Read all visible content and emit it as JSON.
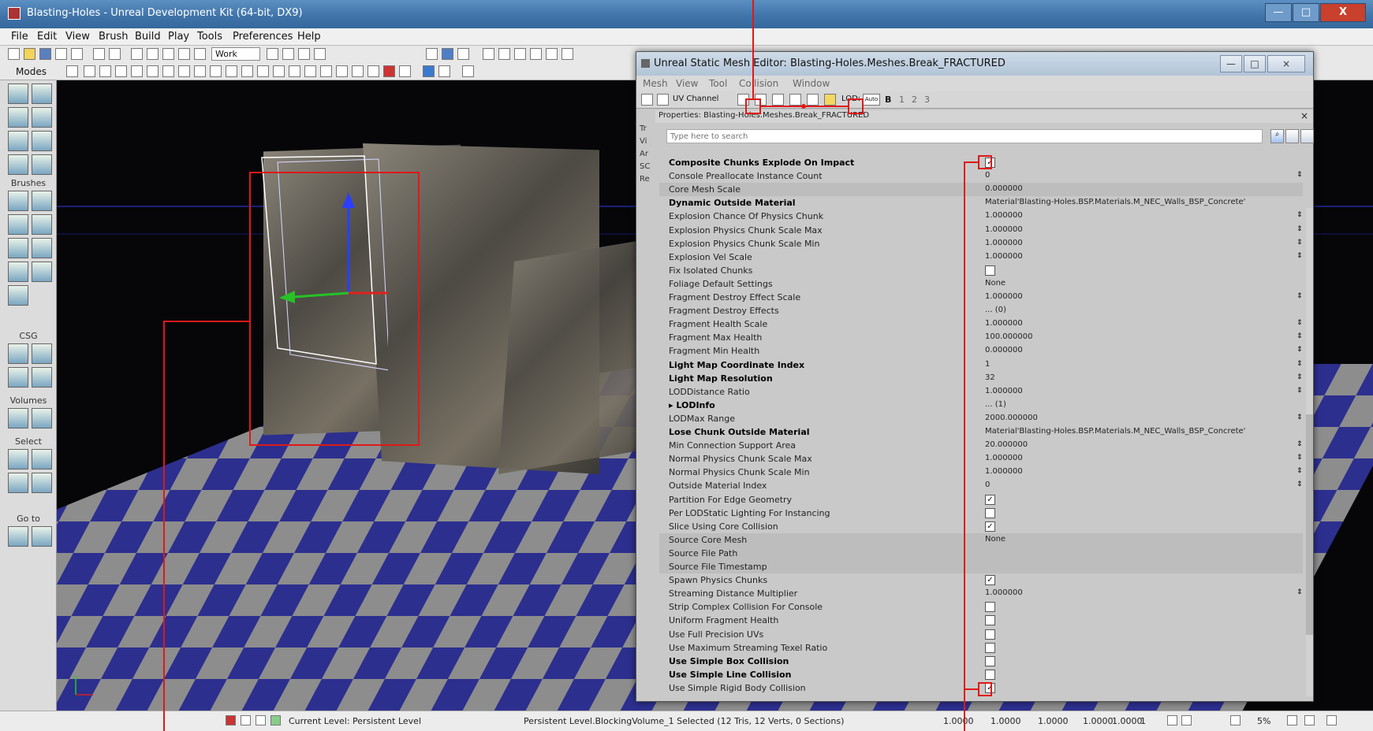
{
  "main_window": {
    "title": "Blasting-Holes - Unreal Development Kit (64-bit, DX9)",
    "min_glyph": "—",
    "max_glyph": "□",
    "close_glyph": "X"
  },
  "menu": [
    "File",
    "Edit",
    "View",
    "Brush",
    "Build",
    "Play",
    "Tools",
    "Preferences",
    "Help"
  ],
  "toolbar": {
    "mode_combo": "Work",
    "modes_label": "Modes"
  },
  "modes_panel": {
    "brushes": "Brushes",
    "csg": "CSG",
    "volumes": "Volumes",
    "select": "Select",
    "goto": "Go to"
  },
  "status_bar": {
    "current_level": "Current Level: Persistent Level",
    "selection": "Persistent Level.BlockingVolume_1 Selected (12 Tris, 12 Verts, 0 Sections)",
    "v1": "1.0000",
    "v2": "1.0000",
    "v3": "1.0000",
    "v4": "1.0000",
    "v5": "1.0000",
    "count": "1",
    "pct": "5%"
  },
  "mesh_editor": {
    "title": "Unreal Static Mesh Editor: Blasting-Holes.Meshes.Break_FRACTURED",
    "menu": [
      "Mesh",
      "View",
      "Tool",
      "Collision",
      "Window"
    ],
    "uv_channel": "UV Channel",
    "lod_label": "LOD:",
    "lod_auto": "Auto",
    "lod_levels": [
      "B",
      "1",
      "2",
      "3"
    ],
    "properties_title": "Properties: Blasting-Holes.Meshes.Break_FRACTURED",
    "close_glyph": "×",
    "search_placeholder": "Type here to search",
    "side_labels": [
      "Tr",
      "Vi",
      "Ar",
      "SC",
      "Re"
    ]
  },
  "properties": [
    {
      "name": "Composite Chunks Explode On Impact",
      "bold": true,
      "checkbox": true,
      "checked": true
    },
    {
      "name": "Console Preallocate Instance Count",
      "value": "0",
      "arrows": true
    },
    {
      "name": "Core Mesh Scale",
      "value": "0.000000",
      "shaded": true
    },
    {
      "name": "Dynamic Outside Material",
      "bold": true,
      "value": "Material'Blasting-Holes.BSP.Materials.M_NEC_Walls_BSP_Concrete'"
    },
    {
      "name": "Explosion Chance Of Physics Chunk",
      "value": "1.000000",
      "arrows": true
    },
    {
      "name": "Explosion Physics Chunk Scale Max",
      "value": "1.000000",
      "arrows": true
    },
    {
      "name": "Explosion Physics Chunk Scale Min",
      "value": "1.000000",
      "arrows": true
    },
    {
      "name": "Explosion Vel Scale",
      "value": "1.000000",
      "arrows": true
    },
    {
      "name": "Fix Isolated Chunks",
      "checkbox": true,
      "checked": false
    },
    {
      "name": "Foliage Default Settings",
      "value": "None"
    },
    {
      "name": "Fragment Destroy Effect Scale",
      "value": "1.000000",
      "arrows": true
    },
    {
      "name": "Fragment Destroy Effects",
      "value": "... (0)"
    },
    {
      "name": "Fragment Health Scale",
      "value": "1.000000",
      "arrows": true
    },
    {
      "name": "Fragment Max Health",
      "value": "100.000000",
      "arrows": true
    },
    {
      "name": "Fragment Min Health",
      "value": "0.000000",
      "arrows": true
    },
    {
      "name": "Light Map Coordinate Index",
      "bold": true,
      "value": "1",
      "arrows": true
    },
    {
      "name": "Light Map Resolution",
      "bold": true,
      "value": "32",
      "arrows": true
    },
    {
      "name": "LODDistance Ratio",
      "value": "1.000000",
      "arrows": true
    },
    {
      "name": "▸ LODInfo",
      "bold": true,
      "value": "... (1)"
    },
    {
      "name": "LODMax Range",
      "value": "2000.000000",
      "arrows": true
    },
    {
      "name": "Lose Chunk Outside Material",
      "bold": true,
      "value": "Material'Blasting-Holes.BSP.Materials.M_NEC_Walls_BSP_Concrete'"
    },
    {
      "name": "Min Connection Support Area",
      "value": "20.000000",
      "arrows": true
    },
    {
      "name": "Normal Physics Chunk Scale Max",
      "value": "1.000000",
      "arrows": true
    },
    {
      "name": "Normal Physics Chunk Scale Min",
      "value": "1.000000",
      "arrows": true
    },
    {
      "name": "Outside Material Index",
      "value": "0",
      "arrows": true
    },
    {
      "name": "Partition For Edge Geometry",
      "checkbox": true,
      "checked": true
    },
    {
      "name": "Per LODStatic Lighting For Instancing",
      "checkbox": true,
      "checked": false
    },
    {
      "name": "Slice Using Core Collision",
      "checkbox": true,
      "checked": true
    },
    {
      "name": "Source Core Mesh",
      "value": "None",
      "shaded": true
    },
    {
      "name": "Source File Path",
      "value": "",
      "shaded": true
    },
    {
      "name": "Source File Timestamp",
      "value": "",
      "shaded": true
    },
    {
      "name": "Spawn Physics Chunks",
      "checkbox": true,
      "checked": true
    },
    {
      "name": "Streaming Distance Multiplier",
      "value": "1.000000",
      "arrows": true
    },
    {
      "name": "Strip Complex Collision For Console",
      "checkbox": true,
      "checked": false
    },
    {
      "name": "Uniform Fragment Health",
      "checkbox": true,
      "checked": false
    },
    {
      "name": "Use Full Precision UVs",
      "checkbox": true,
      "checked": false
    },
    {
      "name": "Use Maximum Streaming Texel Ratio",
      "checkbox": true,
      "checked": false
    },
    {
      "name": "Use Simple Box Collision",
      "bold": true,
      "checkbox": true,
      "checked": false
    },
    {
      "name": "Use Simple Line Collision",
      "bold": true,
      "checkbox": true,
      "checked": false
    },
    {
      "name": "Use Simple Rigid Body Collision",
      "checkbox": true,
      "checked": true
    }
  ],
  "colors": {
    "annotation": "#e01818",
    "floor_blue": "#2c2f8e",
    "floor_gray": "#8d8d8d"
  }
}
